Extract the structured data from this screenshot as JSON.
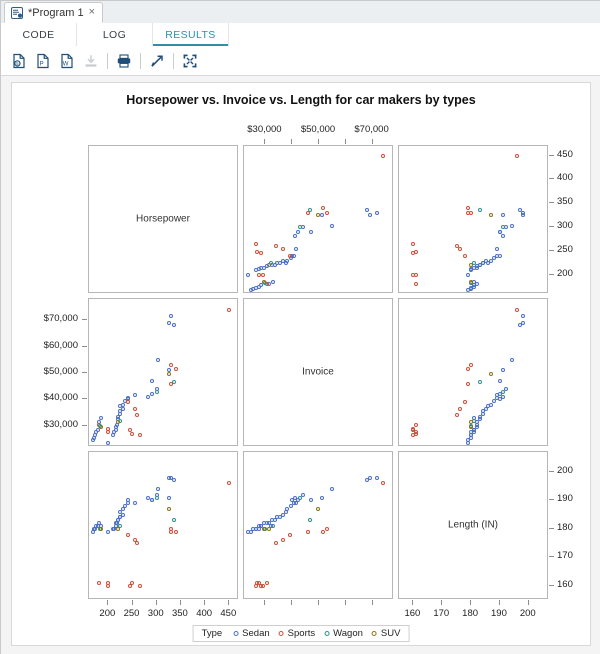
{
  "window": {
    "document_tab": {
      "title": "*Program 1",
      "close_label": "×",
      "icon": "sas-program-icon"
    }
  },
  "subtabs": [
    {
      "label": "CODE",
      "active": false
    },
    {
      "label": "LOG",
      "active": false
    },
    {
      "label": "RESULTS",
      "active": true
    }
  ],
  "toolbar": {
    "buttons": [
      {
        "name": "export-html-icon",
        "label": "Export as HTML",
        "disabled": false
      },
      {
        "name": "export-pdf-icon",
        "label": "Export as PDF",
        "disabled": false
      },
      {
        "name": "export-word-icon",
        "label": "Export as Word",
        "disabled": false
      },
      {
        "name": "download-icon",
        "label": "Download",
        "disabled": true
      },
      {
        "name": "print-icon",
        "label": "Print",
        "disabled": false
      },
      {
        "name": "open-in-new-window-icon",
        "label": "Open in new window",
        "disabled": false
      },
      {
        "name": "maximize-view-icon",
        "label": "Maximize view",
        "disabled": false
      }
    ]
  },
  "chart_data": {
    "type": "scatter",
    "title": "Horsepower vs. Invoice vs. Length for car makers by types",
    "layout": "scatter-plot-matrix",
    "grid": false,
    "variables": [
      {
        "key": "hp",
        "label": "Horsepower",
        "range": [
          160,
          470
        ],
        "ticks": [
          200,
          250,
          300,
          350,
          400,
          450
        ],
        "ticklabels": [
          "200",
          "250",
          "300",
          "350",
          "400",
          "450"
        ]
      },
      {
        "key": "inv",
        "label": "Invoice",
        "range": [
          22000,
          78000
        ],
        "ticks": [
          30000,
          40000,
          50000,
          60000,
          70000
        ],
        "ticklabels": [
          "$30,000",
          "$40,000",
          "$50,000",
          "$60,000",
          "$70,000"
        ],
        "top_ticklabels": [
          "$30,000",
          "$50,000",
          "$70,000"
        ]
      },
      {
        "key": "len",
        "label": "Length (IN)",
        "range": [
          155,
          207
        ],
        "ticks": [
          160,
          170,
          180,
          190,
          200
        ],
        "ticklabels": [
          "160",
          "170",
          "180",
          "190",
          "200"
        ]
      }
    ],
    "legend": {
      "title": "Type",
      "position": "bottom",
      "entries": [
        {
          "label": "Sedan",
          "color": "#4a6fc4"
        },
        {
          "label": "Sports",
          "color": "#c9503a"
        },
        {
          "label": "Wagon",
          "color": "#2f8f8f"
        },
        {
          "label": "SUV",
          "color": "#8a7318"
        }
      ]
    },
    "points": [
      {
        "type": "Sports",
        "hp": 450,
        "inv": 74000,
        "len": 196
      },
      {
        "type": "Sedan",
        "hp": 330,
        "inv": 71500,
        "len": 198
      },
      {
        "type": "Sedan",
        "hp": 325,
        "inv": 69000,
        "len": 198
      },
      {
        "type": "Sedan",
        "hp": 335,
        "inv": 68000,
        "len": 197
      },
      {
        "type": "Sedan",
        "hp": 302,
        "inv": 55000,
        "len": 194
      },
      {
        "type": "Sports",
        "hp": 330,
        "inv": 53000,
        "len": 180
      },
      {
        "type": "Sports",
        "hp": 340,
        "inv": 51500,
        "len": 179
      },
      {
        "type": "Sedan",
        "hp": 325,
        "inv": 51000,
        "len": 191
      },
      {
        "type": "SUV",
        "hp": 325,
        "inv": 49500,
        "len": 187
      },
      {
        "type": "Sedan",
        "hp": 290,
        "inv": 47000,
        "len": 190
      },
      {
        "type": "Wagon",
        "hp": 335,
        "inv": 46500,
        "len": 183
      },
      {
        "type": "Sports",
        "hp": 330,
        "inv": 46000,
        "len": 179
      },
      {
        "type": "Sedan",
        "hp": 255,
        "inv": 41500,
        "len": 189
      },
      {
        "type": "Sedan",
        "hp": 240,
        "inv": 40500,
        "len": 189
      },
      {
        "type": "Sedan",
        "hp": 240,
        "inv": 40000,
        "len": 190
      },
      {
        "type": "Sedan",
        "hp": 235,
        "inv": 39500,
        "len": 188
      },
      {
        "type": "Sports",
        "hp": 240,
        "inv": 39000,
        "len": 178
      },
      {
        "type": "Sedan",
        "hp": 230,
        "inv": 38000,
        "len": 187
      },
      {
        "type": "Sedan",
        "hp": 225,
        "inv": 37500,
        "len": 186
      },
      {
        "type": "Sedan",
        "hp": 230,
        "inv": 36500,
        "len": 185
      },
      {
        "type": "Sedan",
        "hp": 225,
        "inv": 35500,
        "len": 184
      },
      {
        "type": "Sedan",
        "hp": 225,
        "inv": 34500,
        "len": 184
      },
      {
        "type": "Sedan",
        "hp": 220,
        "inv": 33500,
        "len": 183
      },
      {
        "type": "Sedan",
        "hp": 220,
        "inv": 32500,
        "len": 183
      },
      {
        "type": "Wagon",
        "hp": 225,
        "inv": 32000,
        "len": 181
      },
      {
        "type": "SUV",
        "hp": 220,
        "inv": 31500,
        "len": 180
      },
      {
        "type": "Sedan",
        "hp": 218,
        "inv": 30500,
        "len": 182
      },
      {
        "type": "Sedan",
        "hp": 215,
        "inv": 29500,
        "len": 182
      },
      {
        "type": "Sedan",
        "hp": 215,
        "inv": 28500,
        "len": 181
      },
      {
        "type": "Sedan",
        "hp": 212,
        "inv": 27500,
        "len": 180
      },
      {
        "type": "Sedan",
        "hp": 210,
        "inv": 26500,
        "len": 180
      },
      {
        "type": "Sports",
        "hp": 260,
        "inv": 34000,
        "len": 175
      },
      {
        "type": "Sports",
        "hp": 255,
        "inv": 36500,
        "len": 176
      },
      {
        "type": "Sedan",
        "hp": 185,
        "inv": 33000,
        "len": 181
      },
      {
        "type": "Sedan",
        "hp": 180,
        "inv": 31500,
        "len": 182
      },
      {
        "type": "Sports",
        "hp": 180,
        "inv": 30500,
        "len": 161
      },
      {
        "type": "Wagon",
        "hp": 182,
        "inv": 30000,
        "len": 180
      },
      {
        "type": "SUV",
        "hp": 185,
        "inv": 29500,
        "len": 180
      },
      {
        "type": "Sedan",
        "hp": 178,
        "inv": 28500,
        "len": 181
      },
      {
        "type": "Sedan",
        "hp": 175,
        "inv": 27500,
        "len": 181
      },
      {
        "type": "Sedan",
        "hp": 172,
        "inv": 26500,
        "len": 180
      },
      {
        "type": "Sedan",
        "hp": 170,
        "inv": 25500,
        "len": 180
      },
      {
        "type": "Sedan",
        "hp": 168,
        "inv": 24500,
        "len": 179
      },
      {
        "type": "Sports",
        "hp": 200,
        "inv": 29000,
        "len": 160
      },
      {
        "type": "Sports",
        "hp": 200,
        "inv": 27500,
        "len": 161
      },
      {
        "type": "Sports",
        "hp": 245,
        "inv": 28500,
        "len": 160
      },
      {
        "type": "Sports",
        "hp": 248,
        "inv": 27000,
        "len": 161
      },
      {
        "type": "Sports",
        "hp": 265,
        "inv": 26500,
        "len": 160
      },
      {
        "type": "Sedan",
        "hp": 200,
        "inv": 23500,
        "len": 179
      },
      {
        "type": "Sedan",
        "hp": 300,
        "inv": 44000,
        "len": 192
      },
      {
        "type": "Wagon",
        "hp": 300,
        "inv": 43000,
        "len": 191
      },
      {
        "type": "Sedan",
        "hp": 290,
        "inv": 42000,
        "len": 190
      },
      {
        "type": "Sedan",
        "hp": 282,
        "inv": 41000,
        "len": 191
      }
    ]
  }
}
